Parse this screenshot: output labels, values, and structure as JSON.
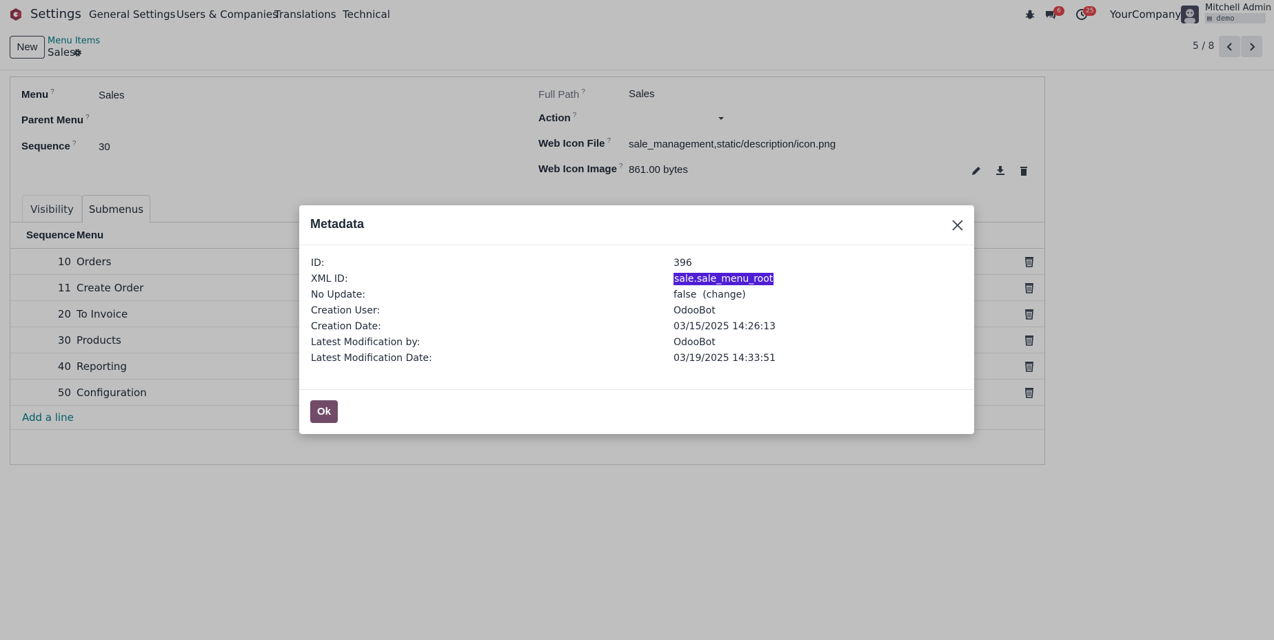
{
  "navbar": {
    "app_name": "Settings",
    "menus": [
      "General Settings",
      "Users & Companies",
      "Translations",
      "Technical"
    ],
    "chat_badge": "6",
    "activity_badge": "25",
    "company": "YourCompany",
    "user_name": "Mitchell Admin",
    "db_name": "demo",
    "brand_color": "#714b67"
  },
  "control_panel": {
    "new_label": "New",
    "breadcrumb_parent": "Menu Items",
    "breadcrumb_current": "Sales",
    "pager": "5 / 8"
  },
  "form": {
    "menu_label": "Menu",
    "menu_value": "Sales",
    "parent_menu_label": "Parent Menu",
    "parent_menu_value": "",
    "sequence_label": "Sequence",
    "sequence_value": "30",
    "full_path_label": "Full Path",
    "full_path_value": "Sales",
    "action_label": "Action",
    "action_value": "",
    "web_icon_file_label": "Web Icon File",
    "web_icon_file_value": "sale_management,static/description/icon.png",
    "web_icon_image_label": "Web Icon Image",
    "web_icon_image_value": "861.00 bytes",
    "help_mark": "?"
  },
  "tabs": [
    {
      "label": "Visibility",
      "active": false
    },
    {
      "label": "Submenus",
      "active": true
    }
  ],
  "submenus": {
    "columns": [
      "Sequence",
      "Menu"
    ],
    "rows": [
      {
        "seq": "10",
        "name": "Orders"
      },
      {
        "seq": "11",
        "name": "Create Order"
      },
      {
        "seq": "20",
        "name": "To Invoice"
      },
      {
        "seq": "30",
        "name": "Products"
      },
      {
        "seq": "40",
        "name": "Reporting"
      },
      {
        "seq": "50",
        "name": "Configuration"
      }
    ],
    "add_line": "Add a line"
  },
  "modal": {
    "title": "Metadata",
    "fields": [
      {
        "key": "ID:",
        "value": "396"
      },
      {
        "key": "XML ID:",
        "value": "sale.sale_menu_root"
      },
      {
        "key": "No Update:",
        "value": "false"
      },
      {
        "key": "Creation User:",
        "value": "OdooBot"
      },
      {
        "key": "Creation Date:",
        "value": "03/15/2025 14:26:13"
      },
      {
        "key": "Latest Modification by:",
        "value": "OdooBot"
      },
      {
        "key": "Latest Modification Date:",
        "value": "03/19/2025 14:33:51"
      }
    ],
    "change_link": "(change)",
    "ok_label": "Ok"
  }
}
